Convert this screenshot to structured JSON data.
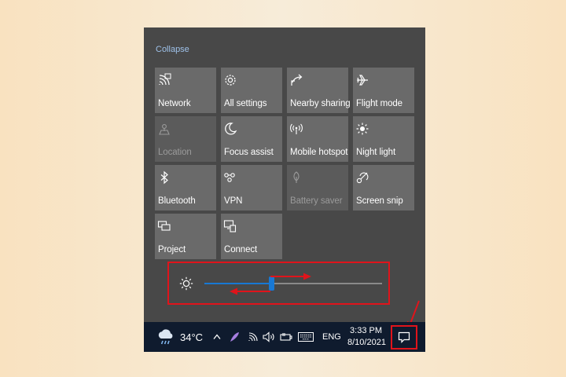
{
  "action_center": {
    "collapse_label": "Collapse",
    "tiles": [
      {
        "label": "Network",
        "icon": "network-icon",
        "enabled": true
      },
      {
        "label": "All settings",
        "icon": "gear-icon",
        "enabled": true
      },
      {
        "label": "Nearby sharing",
        "icon": "share-icon",
        "enabled": true
      },
      {
        "label": "Flight mode",
        "icon": "airplane-icon",
        "enabled": true
      },
      {
        "label": "Location",
        "icon": "location-icon",
        "enabled": false
      },
      {
        "label": "Focus assist",
        "icon": "moon-icon",
        "enabled": true
      },
      {
        "label": "Mobile hotspot",
        "icon": "hotspot-icon",
        "enabled": true
      },
      {
        "label": "Night light",
        "icon": "sun-icon",
        "enabled": true
      },
      {
        "label": "Bluetooth",
        "icon": "bluetooth-icon",
        "enabled": true
      },
      {
        "label": "VPN",
        "icon": "vpn-icon",
        "enabled": true
      },
      {
        "label": "Battery saver",
        "icon": "leaf-icon",
        "enabled": false
      },
      {
        "label": "Screen snip",
        "icon": "scissors-icon",
        "enabled": true
      },
      {
        "label": "Project",
        "icon": "project-icon",
        "enabled": true
      },
      {
        "label": "Connect",
        "icon": "connect-icon",
        "enabled": true
      }
    ],
    "brightness": {
      "icon": "brightness-icon",
      "level_fraction": 0.38
    }
  },
  "taskbar": {
    "temperature": "34°C",
    "weather_icon": "cloud-rain-icon",
    "language": "ENG",
    "time": "3:33 PM",
    "date": "8/10/2021",
    "tray_icons": [
      "chevron-up-icon",
      "feather-icon",
      "wifi-icon",
      "speaker-icon",
      "battery-icon",
      "keyboard-icon"
    ],
    "notification_icon": "notification-icon"
  },
  "colors": {
    "highlight": "#e0141b",
    "accent": "#1878d4",
    "panel": "#484848",
    "tile": "#6a6a6a",
    "taskbar": "#0f1b2e"
  }
}
